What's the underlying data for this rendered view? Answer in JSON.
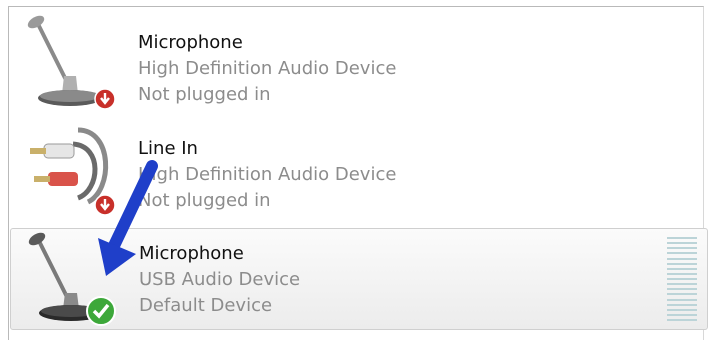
{
  "devices": [
    {
      "name": "Microphone",
      "driver": "High Definition Audio Device",
      "status": "Not plugged in",
      "icon": "microphone-icon",
      "badge": "down-arrow-badge-icon",
      "selected": false
    },
    {
      "name": "Line In",
      "driver": "High Definition Audio Device",
      "status": "Not plugged in",
      "icon": "rca-cable-icon",
      "badge": "down-arrow-badge-icon",
      "selected": false
    },
    {
      "name": "Microphone",
      "driver": "USB Audio Device",
      "status": "Default Device",
      "icon": "microphone-icon",
      "badge": "checkmark-badge-icon",
      "selected": true,
      "level": 0
    }
  ],
  "colors": {
    "badge_red": "#c8302a",
    "badge_green": "#3da83a",
    "arrow_blue": "#1f3fc9",
    "selected_background": "#ececec"
  }
}
